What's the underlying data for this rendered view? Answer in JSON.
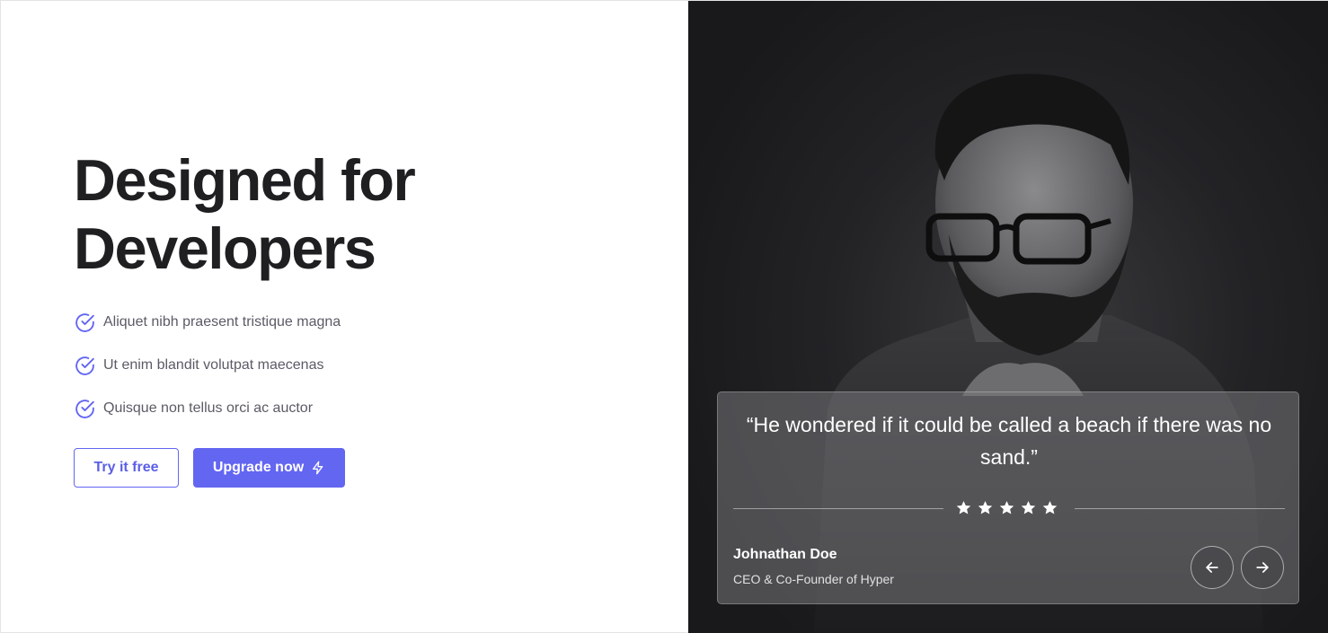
{
  "hero": {
    "title_line1": "Designed for",
    "title_line2": "Developers",
    "features": [
      {
        "text": "Aliquet nibh praesent tristique magna",
        "icon": "check-circle-icon"
      },
      {
        "text": "Ut enim blandit volutpat maecenas",
        "icon": "check-circle-icon"
      },
      {
        "text": "Quisque non tellus orci ac auctor",
        "icon": "check-circle-icon"
      }
    ],
    "try_label": "Try it free",
    "upgrade_label": "Upgrade now",
    "upgrade_icon": "lightning-icon"
  },
  "testimonial": {
    "quote": "“He wondered if it could be called a beach if there was no sand.”",
    "rating": 5,
    "author": "Johnathan Doe",
    "role": "CEO & Co-Founder of Hyper",
    "prev_icon": "arrow-left-icon",
    "next_icon": "arrow-right-icon"
  },
  "colors": {
    "accent": "#6366f1",
    "heading": "#1f1f22",
    "body_text": "#5b5b66",
    "dark_panel": "#232326"
  }
}
